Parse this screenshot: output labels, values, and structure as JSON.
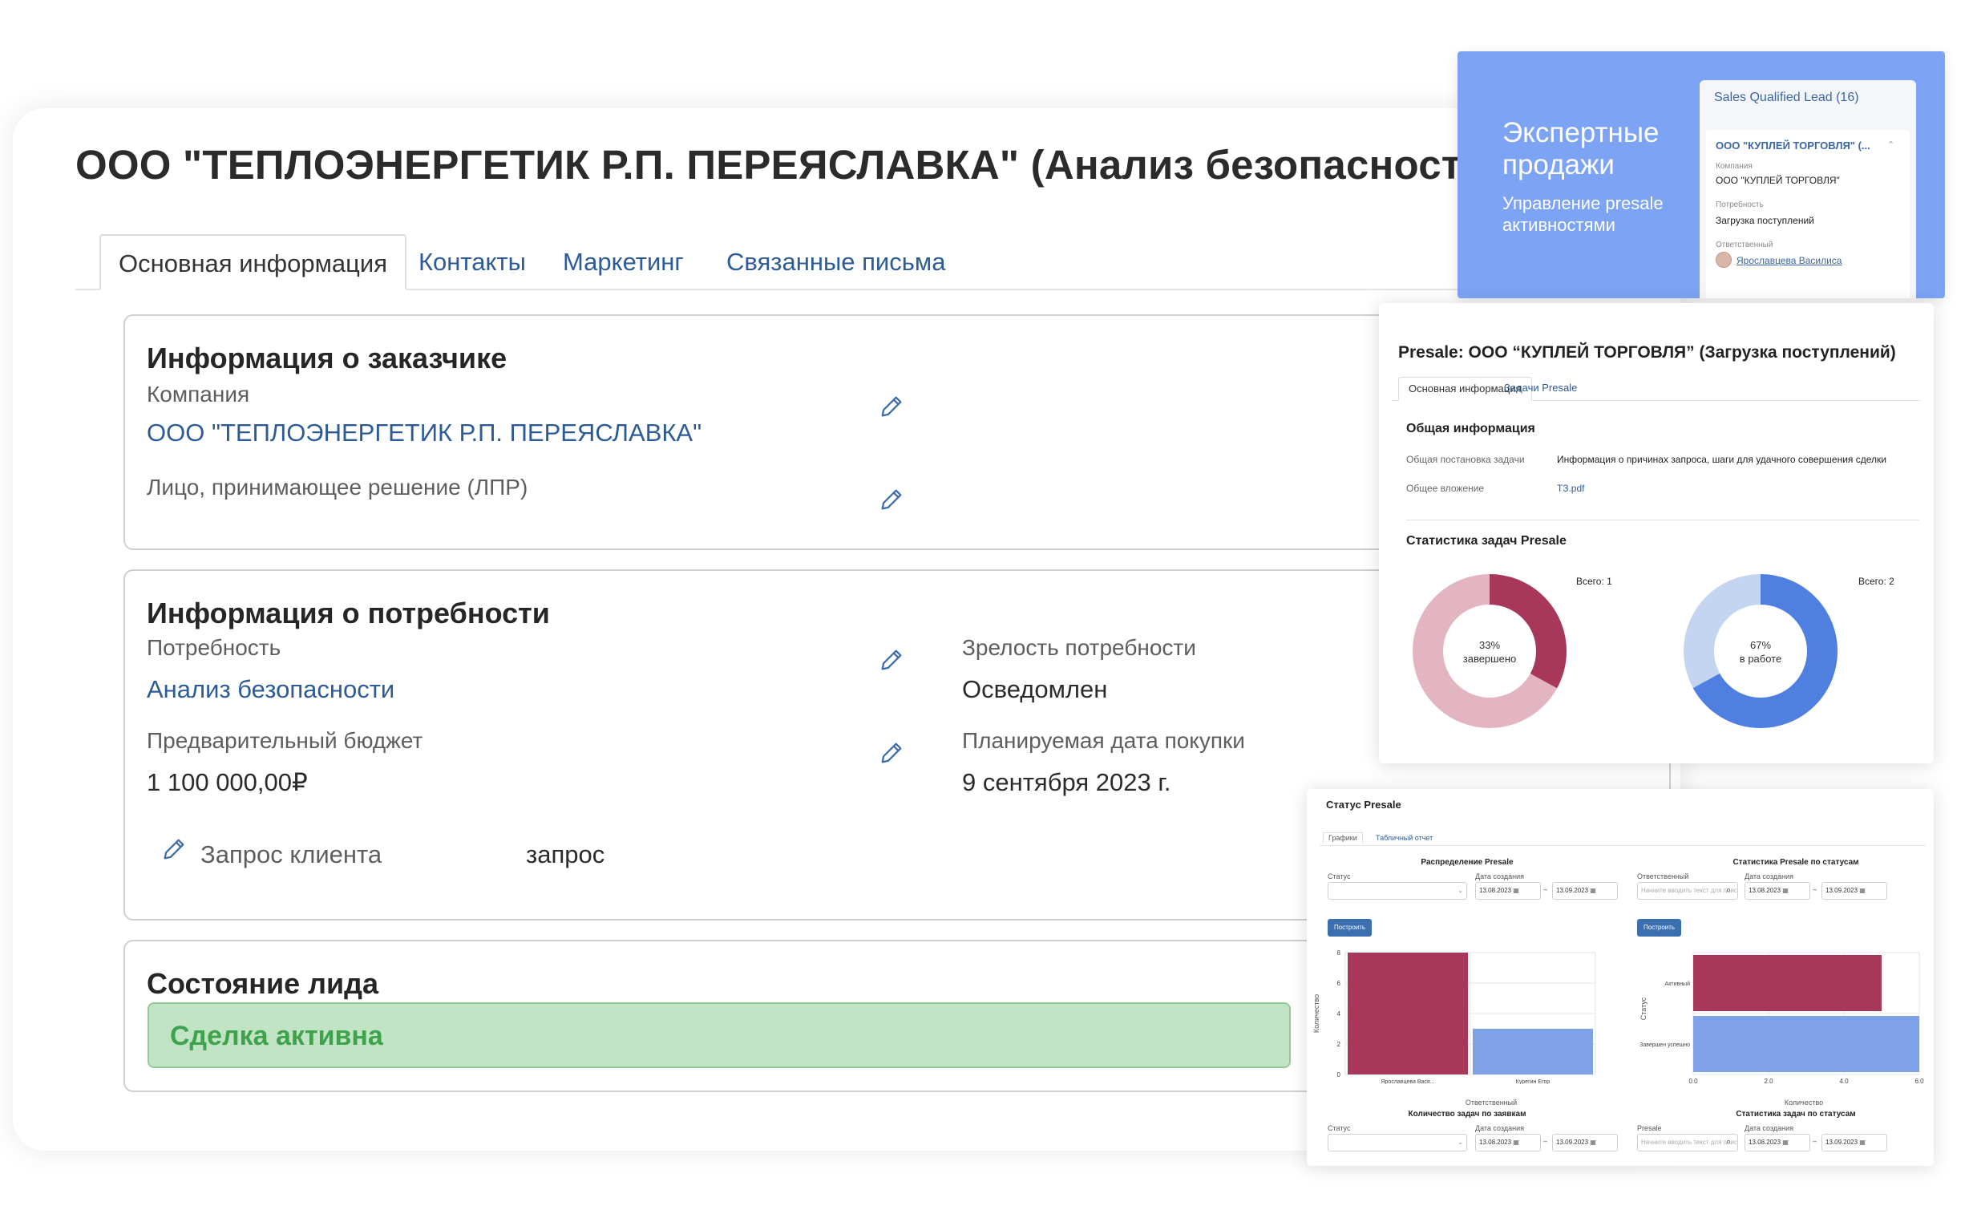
{
  "main": {
    "title": "ООО \"ТЕПЛОЭНЕРГЕТИК Р.П. ПЕРЕЯСЛАВКА\" (Анализ безопасности )",
    "tabs": [
      {
        "label": "Основная информация"
      },
      {
        "label": "Контакты"
      },
      {
        "label": "Маркетинг"
      },
      {
        "label": "Связанные письма"
      }
    ],
    "customer": {
      "title": "Информация о заказчике",
      "company_label": "Компания",
      "company_value": "ООО \"ТЕПЛОЭНЕРГЕТИК Р.П. ПЕРЕЯСЛАВКА\"",
      "dm_label": "Лицо, принимающее решение (ЛПР)"
    },
    "need": {
      "title": "Информация о потребности",
      "need_label": "Потребность",
      "need_value": "Анализ безопасности",
      "maturity_label": "Зрелость потребности",
      "maturity_value": "Осведомлен",
      "budget_label": "Предварительный бюджет",
      "budget_value": "1 100 000,00₽",
      "date_label": "Планируемая дата покупки",
      "date_value": "9 сентября 2023 г.",
      "request_label": "Запрос клиента",
      "request_value": "запрос"
    },
    "lead_state": {
      "title": "Состояние лида",
      "status": "Сделка активна"
    }
  },
  "promo": {
    "title": "Экспертные продажи",
    "subtitle": "Управление presale активностями",
    "sql_card": {
      "title": "Sales Qualified Lead (16)",
      "item_title": "ООО \"КУПЛЕЙ ТОРГОВЛЯ\" (...",
      "company_label": "Компания",
      "company_value": "ООО \"КУПЛЕЙ ТОРГОВЛЯ\"",
      "need_label": "Потребность",
      "need_value": "Загрузка поступлений",
      "owner_label": "Ответственный",
      "owner_value": "Ярославцева Василиса"
    }
  },
  "presale": {
    "title": "Presale: ООО “КУПЛЕЙ ТОРГОВЛЯ” (Загрузка поступлений)",
    "tabs": [
      {
        "label": "Основная информация"
      },
      {
        "label": "Задачи Presale"
      }
    ],
    "general_title": "Общая информация",
    "task_label": "Общая постановка задачи",
    "task_value": "Информация о причинах запроса, шаги для удачного совершения сделки",
    "attach_label": "Общее вложение",
    "attach_value": "ТЗ.pdf",
    "stats_title": "Статистика задач Presale",
    "donuts": [
      {
        "total": "Всего: 1",
        "percent": "33%",
        "caption": "завершено",
        "fraction": 0.33,
        "main_color": "#a8385a",
        "rest_color": "#e3b5c1"
      },
      {
        "total": "Всего: 2",
        "percent": "67%",
        "caption": "в работе",
        "fraction": 0.67,
        "main_color": "#4f7fe0",
        "rest_color": "#c4d5f2"
      }
    ]
  },
  "status_presale": {
    "title": "Статус Presale",
    "tabs": [
      {
        "label": "Графики"
      },
      {
        "label": "Табличный отчет"
      }
    ],
    "left": {
      "title": "Распределение Presale",
      "field1_label": "Статус",
      "date_label": "Дата создания",
      "date_from": "13.08.2023",
      "date_to": "13.09.2023",
      "button": "Построить"
    },
    "right": {
      "title": "Статистика Presale по статусам",
      "field1_label": "Ответственный",
      "field1_placeholder": "Начните вводить текст для поиска",
      "date_label": "Дата создания",
      "date_from": "13.08.2023",
      "date_to": "13.09.2023",
      "button": "Построить"
    },
    "bottom_left": {
      "title": "Количество задач по заявкам",
      "field1_label": "Статус",
      "date_label": "Дата создания",
      "date_from": "13.08.2023",
      "date_to": "13.09.2023"
    },
    "bottom_right": {
      "title": "Статистика задач по статусам",
      "field1_label": "Presale",
      "field1_placeholder": "Начните вводить текст для поиска",
      "date_label": "Дата создания",
      "date_from": "13.08.2023",
      "date_to": "13.09.2023"
    }
  },
  "chart_data": [
    {
      "type": "bar",
      "orientation": "vertical",
      "categories": [
        "Ярославцева Вася...",
        "Курегин Егор"
      ],
      "values": [
        8,
        3
      ],
      "colors": [
        "#a8385a",
        "#7ea1e8"
      ],
      "xlabel": "Ответственный",
      "ylabel": "Количество",
      "ylim": [
        0,
        8
      ],
      "yticks": [
        "0",
        "2",
        "4",
        "6",
        "8"
      ]
    },
    {
      "type": "bar",
      "orientation": "horizontal",
      "categories": [
        "Активный",
        "Завершен успешно"
      ],
      "values": [
        5.0,
        6.0
      ],
      "colors": [
        "#a8385a",
        "#7ea1e8"
      ],
      "xlabel": "Количество",
      "ylabel": "Статус",
      "xlim": [
        0,
        6
      ],
      "xticks": [
        "0.0",
        "2.0",
        "4.0",
        "6.0"
      ]
    }
  ]
}
